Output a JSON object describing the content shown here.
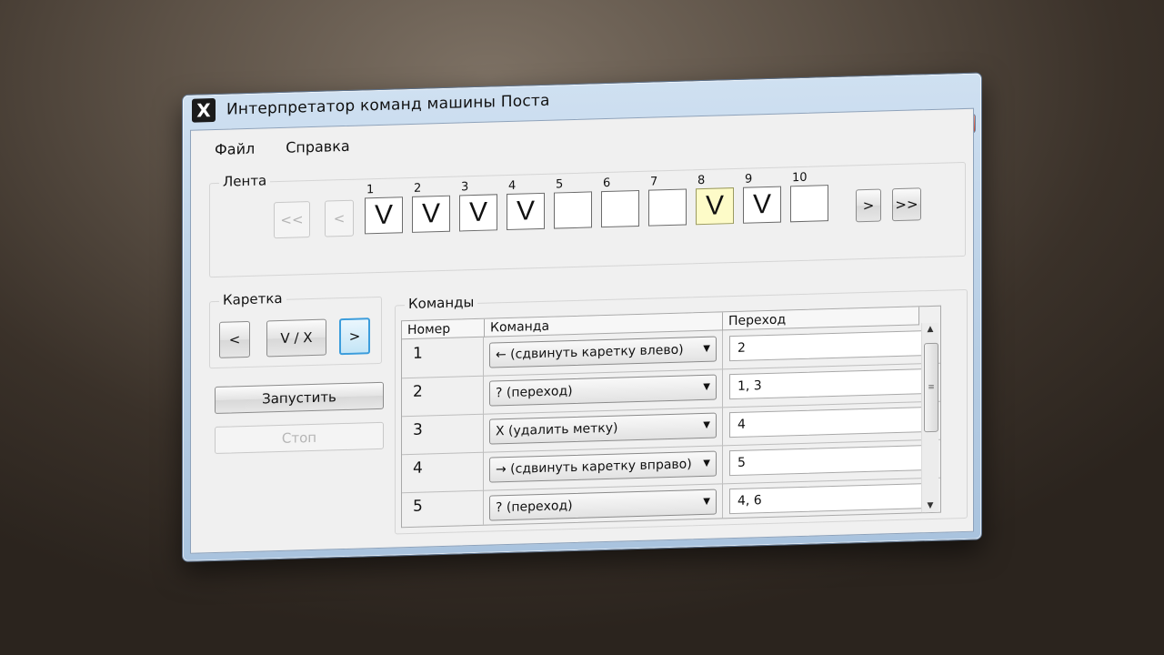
{
  "window": {
    "title": "Интерпретатор команд машины Поста",
    "icon": "X",
    "controls": {
      "minimize": "▁",
      "maximize": "□",
      "close": "✕"
    }
  },
  "menu": [
    "Файл",
    "Справка"
  ],
  "tape": {
    "group_title": "Лента",
    "nav_first": "<<",
    "nav_prev": "<",
    "nav_next": ">",
    "nav_last": ">>",
    "cells": [
      {
        "num": "1",
        "mark": "V"
      },
      {
        "num": "2",
        "mark": "V"
      },
      {
        "num": "3",
        "mark": "V"
      },
      {
        "num": "4",
        "mark": "V"
      },
      {
        "num": "5",
        "mark": ""
      },
      {
        "num": "6",
        "mark": ""
      },
      {
        "num": "7",
        "mark": ""
      },
      {
        "num": "8",
        "mark": "V"
      },
      {
        "num": "9",
        "mark": "V"
      },
      {
        "num": "10",
        "mark": ""
      }
    ],
    "caret_cell_index": 7
  },
  "carriage": {
    "group_title": "Каретка",
    "left": "<",
    "toggle": "V / X",
    "right": ">"
  },
  "actions": {
    "run": "Запустить",
    "stop": "Стоп"
  },
  "commands": {
    "group_title": "Команды",
    "headers": [
      "Номер",
      "Команда",
      "Переход"
    ],
    "rows": [
      {
        "num": "1",
        "command": "← (сдвинуть каретку влево)",
        "goto": "2"
      },
      {
        "num": "2",
        "command": "? (переход)",
        "goto": "1, 3"
      },
      {
        "num": "3",
        "command": "X (удалить метку)",
        "goto": "4"
      },
      {
        "num": "4",
        "command": "→ (сдвинуть каретку вправо)",
        "goto": "5"
      },
      {
        "num": "5",
        "command": "? (переход)",
        "goto": "4, 6"
      }
    ],
    "scroll_up": "▲",
    "scroll_down": "▼",
    "scroll_grip": "≡"
  }
}
